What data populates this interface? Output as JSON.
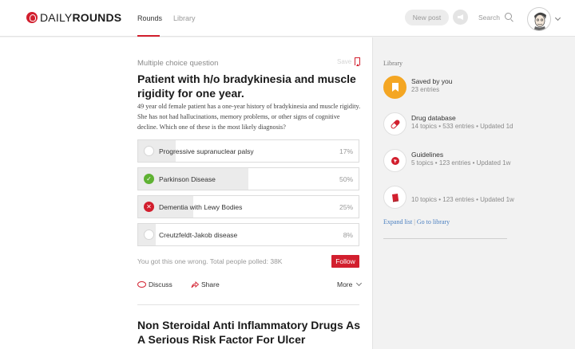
{
  "brand": {
    "name_light": "DAILY",
    "name_bold": "ROUNDS"
  },
  "nav": {
    "tabs": [
      "Rounds",
      "Library"
    ]
  },
  "header": {
    "new_post": "New post",
    "search": "Search"
  },
  "question": {
    "type": "Multiple choice question",
    "save": "Save",
    "title": "Patient with h/o bradykinesia and muscle rigidity for one year.",
    "body": "49 year old female patient has a one-year history of bradykinesia and muscle rigidity. She has not had hallucinations, memory problems, or other signs of cognitive decline. Which one of these is the most likely diagnosis?",
    "options": [
      {
        "label": "Progressive supranuclear palsy",
        "percent": "17%",
        "fraction": 0.17,
        "state": "none"
      },
      {
        "label": "Parkinson Disease",
        "percent": "50%",
        "fraction": 0.5,
        "state": "correct"
      },
      {
        "label": "Dementia with Lewy Bodies",
        "percent": "25%",
        "fraction": 0.25,
        "state": "wrong"
      },
      {
        "label": "Creutzfeldt-Jakob disease",
        "percent": "8%",
        "fraction": 0.08,
        "state": "none"
      }
    ],
    "poll_note": "You got this one wrong. Total people polled: 38K",
    "follow": "Follow",
    "actions": {
      "discuss": "Discuss",
      "share": "Share",
      "more": "More"
    }
  },
  "next_post": {
    "title": "Non Steroidal Anti Inflammatory Drugs As A Serious Risk Factor For Ulcer"
  },
  "sidebar": {
    "title": "Library",
    "items": [
      {
        "name": "Saved by you",
        "meta": "23 entries",
        "icon": "bookmark-icon"
      },
      {
        "name": "Drug database",
        "meta": "14 topics • 533 entries • Updated 1d",
        "icon": "pill-icon"
      },
      {
        "name": "Guidelines",
        "meta": "5 topics • 123 entries • Updated 1w",
        "icon": "guidelines-icon"
      },
      {
        "name": "",
        "meta": "10 topics • 123 entries • Updated 1w",
        "icon": "book-icon"
      }
    ],
    "links": {
      "expand": "Expand list",
      "separator": "|",
      "goto": "Go to library"
    }
  },
  "colors": {
    "brand_red": "#d21f2e",
    "correct_green": "#5fb233",
    "saved_orange": "#f4a623",
    "link_blue": "#4a7fc0"
  }
}
